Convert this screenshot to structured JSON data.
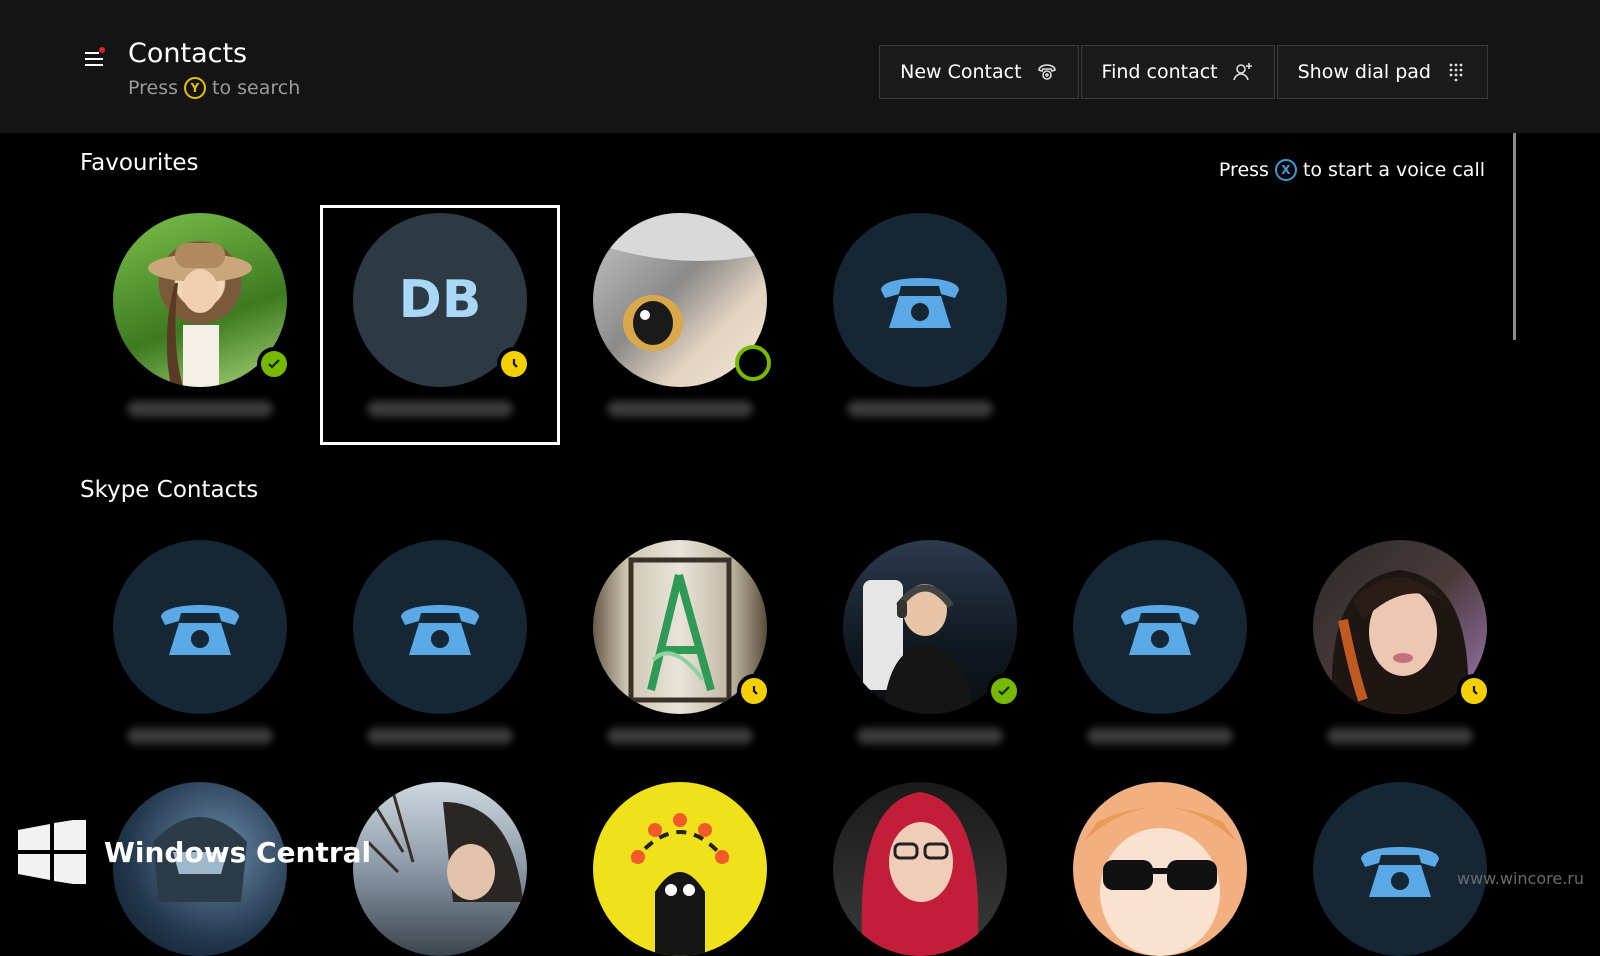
{
  "header": {
    "title": "Contacts",
    "search_hint_prefix": "Press",
    "search_hint_button": "Y",
    "search_hint_suffix": "to search",
    "buttons": [
      {
        "label": "New Contact",
        "icon": "new-contact-icon"
      },
      {
        "label": "Find contact",
        "icon": "add-person-icon"
      },
      {
        "label": "Show dial pad",
        "icon": "dial-pad-icon"
      }
    ]
  },
  "favourites": {
    "title": "Favourites",
    "voice_hint_prefix": "Press",
    "voice_hint_button": "X",
    "voice_hint_suffix": "to start a voice call",
    "contacts": [
      {
        "kind": "photo",
        "photo": "woman-hat",
        "status": "online"
      },
      {
        "kind": "initials",
        "initials": "DB",
        "status": "away",
        "focused": true
      },
      {
        "kind": "photo",
        "photo": "cat",
        "status": "online-ring"
      },
      {
        "kind": "phone",
        "status": "none"
      }
    ]
  },
  "skype_contacts": {
    "title": "Skype Contacts",
    "row1": [
      {
        "kind": "phone",
        "status": "none"
      },
      {
        "kind": "phone",
        "status": "none"
      },
      {
        "kind": "photo",
        "photo": "stained-glass",
        "status": "away"
      },
      {
        "kind": "photo",
        "photo": "gamer-headset",
        "status": "online"
      },
      {
        "kind": "phone",
        "status": "none"
      },
      {
        "kind": "photo",
        "photo": "dark-hair-woman",
        "status": "away"
      }
    ],
    "row2": [
      {
        "kind": "photo",
        "photo": "armored-soldier"
      },
      {
        "kind": "photo",
        "photo": "winter-person"
      },
      {
        "kind": "photo",
        "photo": "yellow-ghost"
      },
      {
        "kind": "photo",
        "photo": "red-hair-woman"
      },
      {
        "kind": "photo",
        "photo": "anime-sunglasses"
      },
      {
        "kind": "phone"
      }
    ]
  },
  "watermarks": {
    "brand": "Windows Central",
    "site": "www.wincore.ru"
  },
  "colors": {
    "accent_blue": "#5aa9e6",
    "online_green": "#76b900",
    "away_yellow": "#f5d000"
  }
}
